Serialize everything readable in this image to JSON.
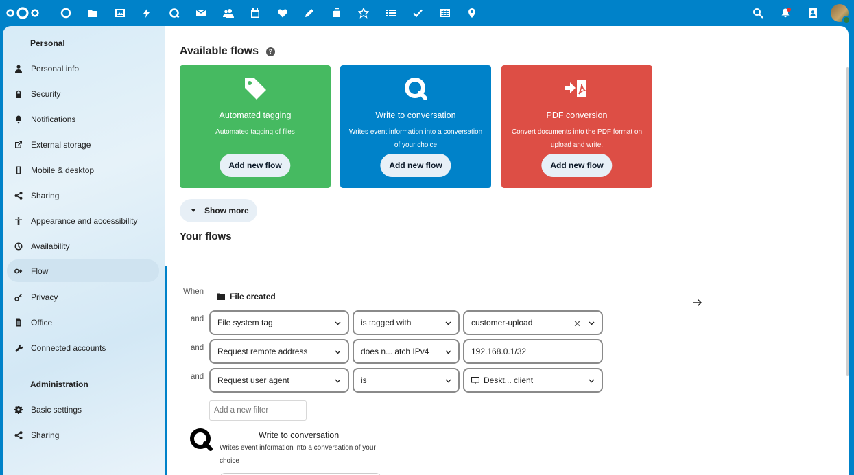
{
  "topbar": {
    "logo_icon": "nextcloud-logo-icon",
    "apps": [
      "dashboard-icon",
      "files-icon",
      "photos-icon",
      "activity-icon",
      "talk-icon",
      "mail-icon",
      "contacts-icon",
      "calendar-icon",
      "favorites-icon",
      "notes-icon",
      "deck-icon",
      "app-store-icon",
      "tasks-list-icon",
      "tasks-check-icon",
      "tables-icon",
      "maps-icon"
    ],
    "right": [
      "search-icon",
      "notifications-icon",
      "contacts-menu-icon",
      "avatar"
    ]
  },
  "sidebar": {
    "personal_caption": "Personal",
    "personal_items": [
      {
        "label": "Personal info",
        "icon": "user-icon"
      },
      {
        "label": "Security",
        "icon": "lock-icon"
      },
      {
        "label": "Notifications",
        "icon": "bell-icon"
      },
      {
        "label": "External storage",
        "icon": "external-link-icon"
      },
      {
        "label": "Mobile & desktop",
        "icon": "phone-icon"
      },
      {
        "label": "Sharing",
        "icon": "share-icon"
      },
      {
        "label": "Appearance and accessibility",
        "icon": "accessibility-icon"
      },
      {
        "label": "Availability",
        "icon": "clock-icon"
      },
      {
        "label": "Flow",
        "icon": "flow-icon",
        "active": true
      },
      {
        "label": "Privacy",
        "icon": "key-icon"
      },
      {
        "label": "Office",
        "icon": "document-icon"
      },
      {
        "label": "Connected accounts",
        "icon": "wrench-icon"
      }
    ],
    "admin_caption": "Administration",
    "admin_items": [
      {
        "label": "Basic settings",
        "icon": "gear-icon"
      },
      {
        "label": "Sharing",
        "icon": "share-icon"
      }
    ]
  },
  "main": {
    "available_title": "Available flows",
    "help_glyph": "?",
    "cards": [
      {
        "title": "Automated tagging",
        "desc": "Automated tagging of files",
        "button": "Add new flow",
        "color": "#46ba61",
        "icon": "tag-icon"
      },
      {
        "title": "Write to conversation",
        "desc": "Writes event information into a conversation of your choice",
        "button": "Add new flow",
        "color": "#0082c9",
        "icon": "talk-icon"
      },
      {
        "title": "PDF conversion",
        "desc": "Convert documents into the PDF format on upload and write.",
        "button": "Add new flow",
        "color": "#e9322d",
        "icon": "pdf-convert-icon"
      }
    ],
    "show_more": "Show more",
    "your_flows_title": "Your flows",
    "rule": {
      "when_label": "When",
      "trigger": "File created",
      "and_label": "and",
      "checks": [
        {
          "check": "File system tag",
          "operator": "is tagged with",
          "value": "customer-upload"
        },
        {
          "check": "Request remote address",
          "operator": "does n... atch IPv4",
          "value": "192.168.0.1/32"
        },
        {
          "check": "Request user agent",
          "operator": "is",
          "value": "Deskt... client"
        }
      ],
      "add_filter_placeholder": "Add a new filter",
      "operation": {
        "title": "Write to conversation",
        "desc": "Writes event information into a conversation of your choice"
      }
    }
  }
}
